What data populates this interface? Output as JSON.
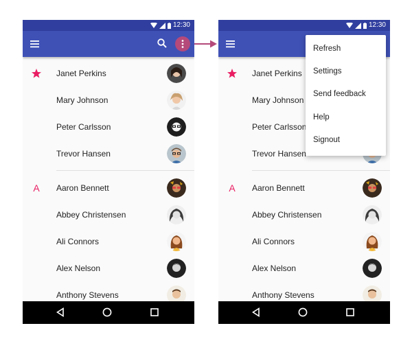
{
  "colors": {
    "primary": "#3f51b5",
    "primary_dark": "#303f9f",
    "accent": "#e91e63",
    "highlight": "#b4497a"
  },
  "status_bar": {
    "time": "12:30"
  },
  "app_bar": {
    "menu_icon": "hamburger-menu-icon",
    "search_icon": "search-icon",
    "overflow_icon": "more-vert-icon"
  },
  "contacts": {
    "starred": [
      {
        "name": "Janet Perkins"
      },
      {
        "name": "Mary Johnson"
      },
      {
        "name": "Peter Carlsson"
      },
      {
        "name": "Trevor Hansen"
      }
    ],
    "section_letter": "A",
    "a_group": [
      {
        "name": "Aaron Bennett"
      },
      {
        "name": "Abbey Christensen"
      },
      {
        "name": "Ali Connors"
      },
      {
        "name": "Alex Nelson"
      },
      {
        "name": "Anthony Stevens"
      }
    ]
  },
  "overflow_menu": {
    "items": [
      "Refresh",
      "Settings",
      "Send feedback",
      "Help",
      "Signout"
    ]
  },
  "nav_bar": {
    "back_icon": "back-triangle-icon",
    "home_icon": "home-circle-icon",
    "recents_icon": "recents-square-icon"
  }
}
